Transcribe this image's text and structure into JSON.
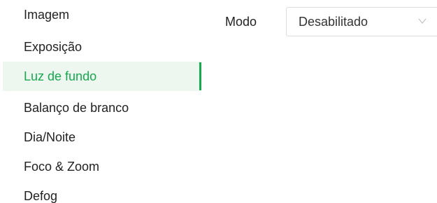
{
  "menu": {
    "items": [
      {
        "label": "Imagem"
      },
      {
        "label": "Exposição"
      },
      {
        "label": "Luz de fundo",
        "active": true
      },
      {
        "label": "Balanço de branco"
      },
      {
        "label": "Dia/Noite"
      },
      {
        "label": "Foco & Zoom"
      },
      {
        "label": "Defog"
      }
    ]
  },
  "form": {
    "mode_label": "Modo",
    "mode_value": "Desabilitado"
  },
  "icons": {
    "dropdown": "chevron-down-icon"
  },
  "colors": {
    "accent": "#16a94e",
    "active_background": "#eef6f0",
    "text": "#222222",
    "border": "#dcdcdc",
    "chevron": "#c4c4c4"
  }
}
